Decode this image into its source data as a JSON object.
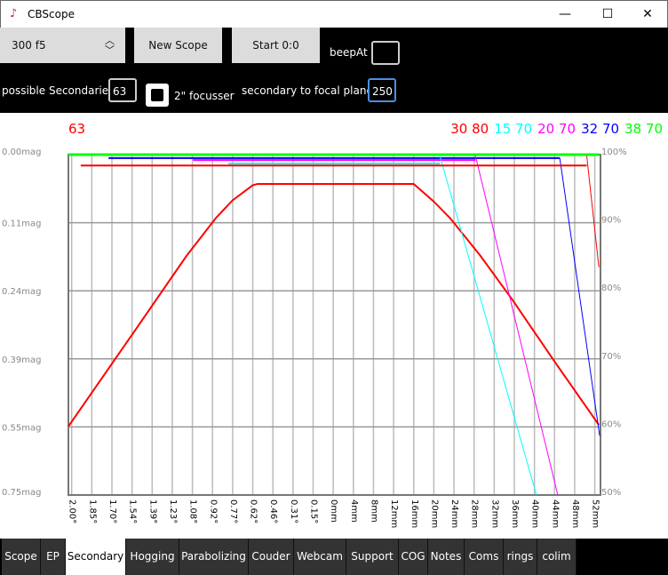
{
  "window": {
    "title": "CBScope",
    "minimize": "—",
    "maximize": "☐",
    "close": "✕"
  },
  "toolbar": {
    "scope_select": "300 f5",
    "new_scope": "New Scope",
    "start": "Start 0:0",
    "beep_label": "beepAt",
    "beep_value": "",
    "possible_label": "possible Secondaries",
    "possible_value": "63",
    "focusser_label": "2\" focusser",
    "focusser_checked": false,
    "focal_label": "secondary to focal plane",
    "focal_value": "250"
  },
  "chart_data": {
    "type": "line",
    "title_left": "63",
    "legend": [
      {
        "text": "30 80",
        "color": "#ff0000"
      },
      {
        "text": "15 70",
        "color": "#00ffff"
      },
      {
        "text": "20 70",
        "color": "#ff00ff"
      },
      {
        "text": "32 70",
        "color": "#0000ff"
      },
      {
        "text": "38 70",
        "color": "#00ff00"
      }
    ],
    "x_ticks": [
      "2.00°",
      "1.85°",
      "1.70°",
      "1.54°",
      "1.39°",
      "1.23°",
      "1.08°",
      "0.92°",
      "0.77°",
      "0.62°",
      "0.46°",
      "0.31°",
      "0.15°",
      "0mm",
      "4mm",
      "8mm",
      "12mm",
      "16mm",
      "20mm",
      "24mm",
      "28mm",
      "32mm",
      "36mm",
      "40mm",
      "44mm",
      "48mm",
      "52mm"
    ],
    "y_left_ticks": [
      "0.00mag",
      "0.11mag",
      "0.24mag",
      "0.39mag",
      "0.55mag",
      "0.75mag"
    ],
    "y_right_ticks": [
      "100%",
      "90%",
      "80%",
      "70%",
      "60%",
      "50%"
    ],
    "ylim": [
      50,
      100
    ],
    "grid": true,
    "series": [
      {
        "color": "#ff0000",
        "width": 2,
        "points": [
          [
            -0.16,
            60.1
          ],
          [
            3.06,
            73.8
          ],
          [
            5.7,
            85.1
          ],
          [
            7.17,
            90.7
          ],
          [
            8.0,
            93.3
          ],
          [
            9.0,
            95.5
          ],
          [
            9.24,
            95.7
          ],
          [
            17.0,
            95.7
          ],
          [
            18.0,
            93.1
          ],
          [
            18.8,
            90.7
          ],
          [
            20.3,
            85.2
          ],
          [
            21.9,
            78.7
          ],
          [
            24.0,
            69.6
          ],
          [
            26.2,
            60.3
          ]
        ]
      },
      {
        "color": "#00ff00",
        "width": 3,
        "points": [
          [
            -0.16,
            100
          ],
          [
            26.2,
            100
          ]
        ]
      },
      {
        "color": "#0000ff",
        "width": 2,
        "points": [
          [
            1.83,
            99.5
          ],
          [
            24.26,
            99.5
          ]
        ]
      },
      {
        "color": "#0000ff",
        "width": 1,
        "points": [
          [
            24.26,
            99.5
          ],
          [
            26.24,
            58.7
          ]
        ]
      },
      {
        "color": "#ff00ff",
        "width": 2,
        "points": [
          [
            6.03,
            99.2
          ],
          [
            20.07,
            99.2
          ]
        ]
      },
      {
        "color": "#ff00ff",
        "width": 1,
        "points": [
          [
            20.07,
            99.8
          ],
          [
            24.16,
            50
          ]
        ]
      },
      {
        "color": "#00ffff",
        "width": 2,
        "points": [
          [
            7.79,
            98.7
          ],
          [
            18.3,
            98.7
          ]
        ]
      },
      {
        "color": "#00ffff",
        "width": 1,
        "points": [
          [
            18.3,
            99.8
          ],
          [
            23.1,
            50
          ]
        ]
      },
      {
        "color": "#ff0000",
        "width": 2,
        "points": [
          [
            0.45,
            98.4
          ],
          [
            25.6,
            98.4
          ]
        ]
      },
      {
        "color": "#ff0000",
        "width": 1,
        "points": [
          [
            25.6,
            99.8
          ],
          [
            26.2,
            83.5
          ]
        ]
      }
    ]
  },
  "tabs": [
    {
      "label": "Scope"
    },
    {
      "label": "EP"
    },
    {
      "label": "Secondary",
      "active": true
    },
    {
      "label": "Hogging"
    },
    {
      "label": "Parabolizing"
    },
    {
      "label": "Couder"
    },
    {
      "label": "Webcam"
    },
    {
      "label": "Support"
    },
    {
      "label": "COG"
    },
    {
      "label": "Notes"
    },
    {
      "label": "Coms"
    },
    {
      "label": "rings"
    },
    {
      "label": "colim"
    }
  ]
}
